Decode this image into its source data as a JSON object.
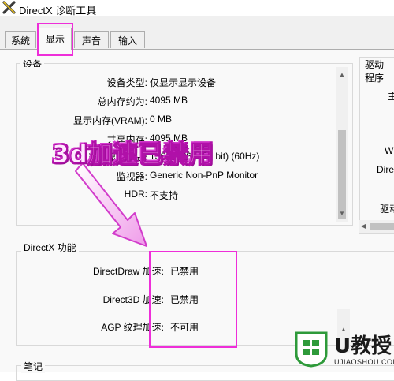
{
  "window": {
    "title": "DirectX 诊断工具"
  },
  "tabs": [
    {
      "label": "系统"
    },
    {
      "label": "显示"
    },
    {
      "label": "声音"
    },
    {
      "label": "输入"
    }
  ],
  "device_group": {
    "legend": "设备",
    "rows": [
      {
        "label": "设备类型:",
        "value": "仅显示显示设备"
      },
      {
        "label": "总内存约为:",
        "value": "4095 MB"
      },
      {
        "label": "显示内存(VRAM):",
        "value": "0 MB"
      },
      {
        "label": "共享内存:",
        "value": "4095 MB"
      },
      {
        "label": "当前显示模式:",
        "value": "1366 x 768 (32 bit) (60Hz)"
      },
      {
        "label": "监视器:",
        "value": "Generic Non-PnP Monitor"
      },
      {
        "label": "HDR:",
        "value": "不支持"
      }
    ]
  },
  "driver_group": {
    "legend": "驱动程序",
    "fragments": [
      "主",
      "W",
      "Dire",
      "驱动"
    ]
  },
  "features_group": {
    "legend": "DirectX 功能",
    "rows": [
      {
        "label": "DirectDraw 加速:",
        "value": "已禁用"
      },
      {
        "label": "Direct3D 加速:",
        "value": "已禁用"
      },
      {
        "label": "AGP 纹理加速:",
        "value": "不可用"
      }
    ]
  },
  "notes_group": {
    "legend": "笔记"
  },
  "annotation": {
    "text": "3d加速已禁用",
    "highlight_color": "#ee2ed9"
  },
  "watermark": {
    "brand": "U教授",
    "url": "UJIAOSHOU.COM"
  }
}
